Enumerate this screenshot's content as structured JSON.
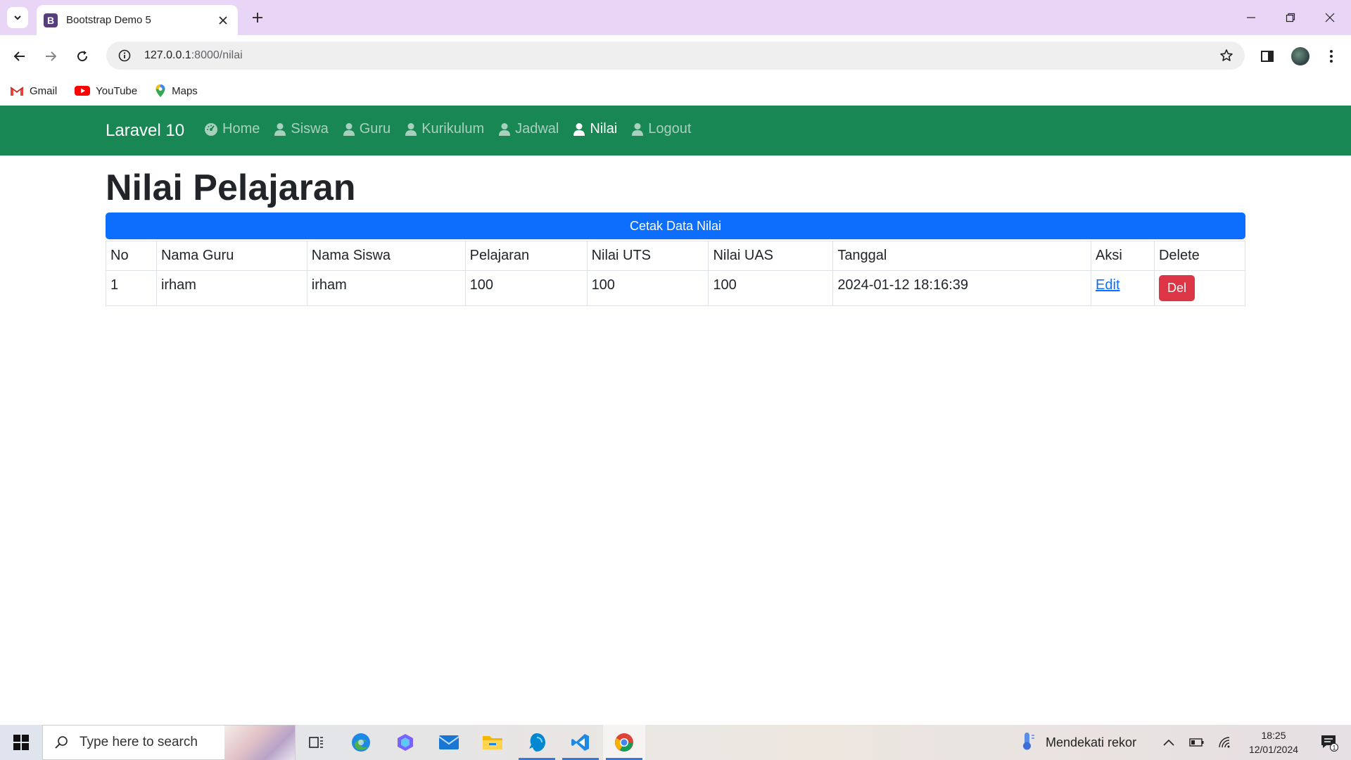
{
  "browser": {
    "tab_title": "Bootstrap Demo 5",
    "tab_favicon_letter": "B",
    "url_host": "127.0.0.1",
    "url_path": ":8000/nilai",
    "bookmarks": [
      {
        "label": "Gmail",
        "icon": "gmail-icon"
      },
      {
        "label": "YouTube",
        "icon": "youtube-icon"
      },
      {
        "label": "Maps",
        "icon": "maps-icon"
      }
    ]
  },
  "navbar": {
    "brand": "Laravel 10",
    "color": "#198754",
    "links": [
      {
        "label": "Home",
        "icon": "dashboard-icon",
        "active": false
      },
      {
        "label": "Siswa",
        "icon": "user-icon",
        "active": false
      },
      {
        "label": "Guru",
        "icon": "user-icon",
        "active": false
      },
      {
        "label": "Kurikulum",
        "icon": "user-icon",
        "active": false
      },
      {
        "label": "Jadwal",
        "icon": "user-icon",
        "active": false
      },
      {
        "label": "Nilai",
        "icon": "user-icon",
        "active": true
      },
      {
        "label": "Logout",
        "icon": "user-icon",
        "active": false
      }
    ]
  },
  "main": {
    "title": "Nilai Pelajaran",
    "print_button": "Cetak Data Nilai",
    "table": {
      "headers": [
        "No",
        "Nama Guru",
        "Nama Siswa",
        "Pelajaran",
        "Nilai UTS",
        "Nilai UAS",
        "Tanggal",
        "Aksi",
        "Delete"
      ],
      "rows": [
        {
          "no": "1",
          "guru": "irham",
          "siswa": "irham",
          "pelajaran": "100",
          "uts": "100",
          "uas": "100",
          "tanggal": "2024-01-12 18:16:39",
          "edit": "Edit",
          "delete": "Del"
        }
      ]
    }
  },
  "taskbar": {
    "search_placeholder": "Type here to search",
    "weather": "Mendekati rekor",
    "time": "18:25",
    "date": "12/01/2024",
    "notification_count": "1"
  }
}
